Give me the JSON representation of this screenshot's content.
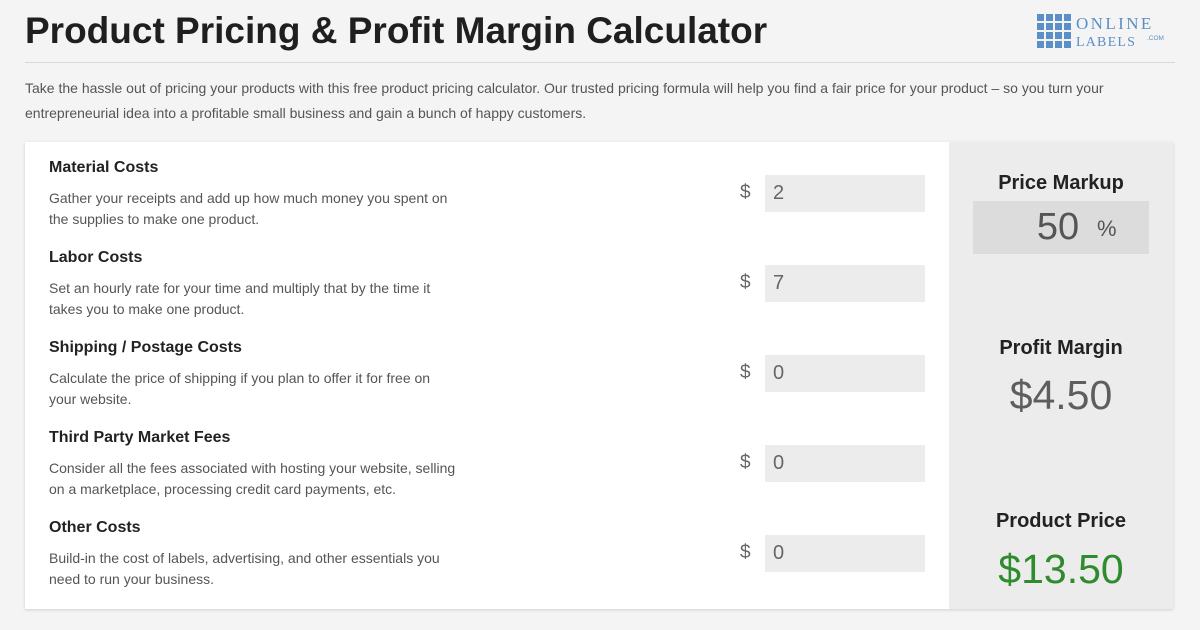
{
  "header": {
    "title": "Product Pricing & Profit Margin Calculator",
    "logo_line1": "ONLINE",
    "logo_line2": "LABELS",
    "logo_suffix": ".COM"
  },
  "intro": "Take the hassle out of pricing your products with this free product pricing calculator. Our trusted pricing formula will help you find a fair price for your product – so you turn your entrepreneurial idea into a profitable small business and gain a bunch of happy customers.",
  "costs": [
    {
      "title": "Material Costs",
      "description": "Gather your receipts and add up how much money you spent on the supplies to make one product.",
      "currency": "$",
      "value": "2"
    },
    {
      "title": "Labor Costs",
      "description": "Set an hourly rate for your time and multiply that by the time it takes you to make one product.",
      "currency": "$",
      "value": "7"
    },
    {
      "title": "Shipping / Postage Costs",
      "description": "Calculate the price of shipping if you plan to offer it for free on your website.",
      "currency": "$",
      "value": "0"
    },
    {
      "title": "Third Party Market Fees",
      "description": "Consider all the fees associated with hosting your website, selling on a marketplace, processing credit card payments, etc.",
      "currency": "$",
      "value": "0"
    },
    {
      "title": "Other Costs",
      "description": "Build-in the cost of labels, advertising, and other essentials you need to run your business.",
      "currency": "$",
      "value": "0"
    }
  ],
  "results": {
    "markup_label": "Price Markup",
    "markup_value": "50",
    "markup_unit": "%",
    "profit_label": "Profit Margin",
    "profit_value": "$4.50",
    "price_label": "Product Price",
    "price_value": "$13.50"
  },
  "colors": {
    "logo_blue": "#5b8fc7",
    "price_green": "#2e8b2e",
    "results_bg": "#ececec",
    "input_bg": "#ececec"
  }
}
